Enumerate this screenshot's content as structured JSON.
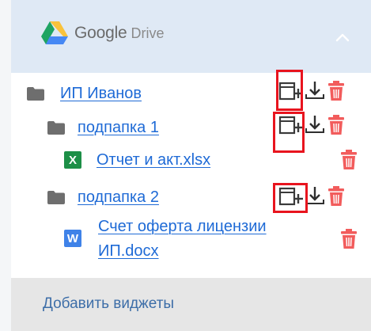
{
  "header": {
    "logo_google": "Google",
    "logo_drive": "Drive",
    "collapse_icon": "chevron-up-icon"
  },
  "tree": [
    {
      "type": "folder",
      "label": "ИП Иванов",
      "actions": [
        "new-folder-icon",
        "download-icon",
        "trash-icon"
      ],
      "highlighted": true
    },
    {
      "type": "folder",
      "label": "подпапка 1",
      "actions": [
        "new-folder-icon",
        "download-icon",
        "trash-icon"
      ],
      "highlighted": true
    },
    {
      "type": "file",
      "file_type": "xlsx",
      "badge": "X",
      "label": "Отчет и акт.xlsx",
      "actions": [
        "trash-icon"
      ]
    },
    {
      "type": "folder",
      "label": "подпапка 2",
      "actions": [
        "new-folder-icon",
        "download-icon",
        "trash-icon"
      ],
      "highlighted": true
    },
    {
      "type": "file",
      "file_type": "docx",
      "badge": "W",
      "label_line1": "Счет оферта лицензии",
      "label_line2": "ИП.docx",
      "actions": [
        "trash-icon"
      ]
    }
  ],
  "footer": {
    "add_widgets": "Добавить виджеты"
  },
  "colors": {
    "link": "#1e6ad6",
    "trash": "#f25c5c",
    "highlight": "#e8141e",
    "header_bg": "#dfe9f5",
    "footer_bg": "#e6e6e6"
  }
}
